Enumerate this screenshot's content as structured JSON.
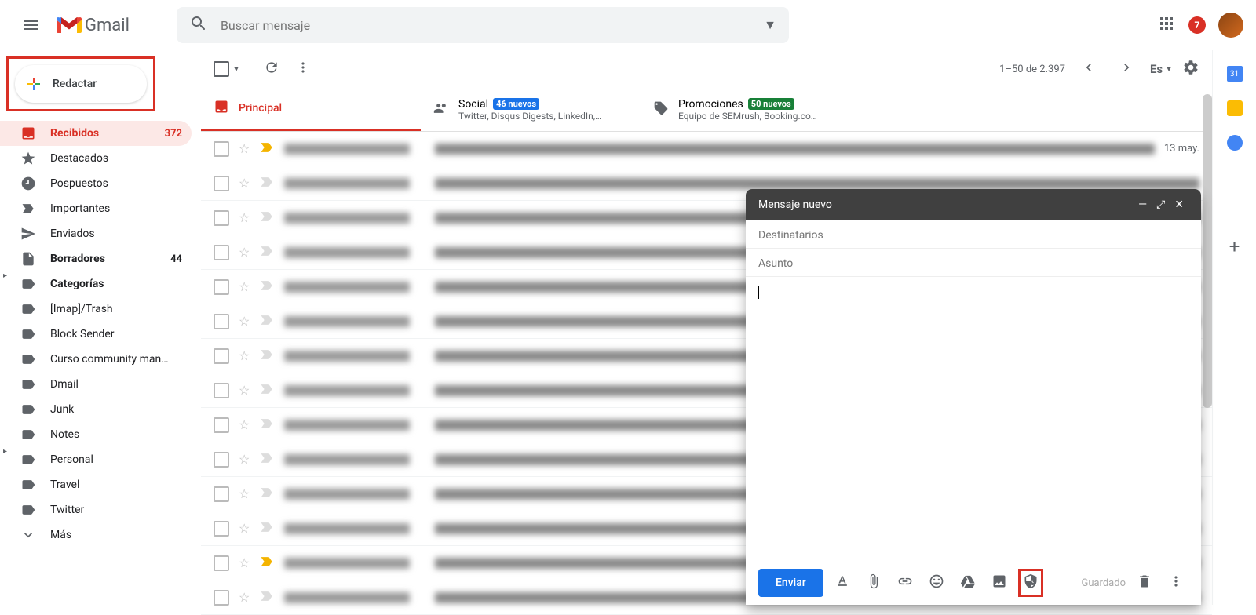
{
  "header": {
    "logo_text": "Gmail",
    "search_placeholder": "Buscar mensaje",
    "notif_count": "7"
  },
  "sidebar": {
    "compose": "Redactar",
    "items": [
      {
        "label": "Recibidos",
        "count": "372",
        "icon": "inbox",
        "active": true
      },
      {
        "label": "Destacados",
        "icon": "star"
      },
      {
        "label": "Pospuestos",
        "icon": "clock"
      },
      {
        "label": "Importantes",
        "icon": "important"
      },
      {
        "label": "Enviados",
        "icon": "sent"
      },
      {
        "label": "Borradores",
        "count": "44",
        "icon": "draft",
        "bold": true
      },
      {
        "label": "Categorías",
        "icon": "label",
        "bold": true,
        "expand": true
      },
      {
        "label": "[Imap]/Trash",
        "icon": "label"
      },
      {
        "label": "Block Sender",
        "icon": "label"
      },
      {
        "label": "Curso community man…",
        "icon": "label"
      },
      {
        "label": "Dmail",
        "icon": "label"
      },
      {
        "label": "Junk",
        "icon": "label"
      },
      {
        "label": "Notes",
        "icon": "label"
      },
      {
        "label": "Personal",
        "icon": "label",
        "expand": true
      },
      {
        "label": "Travel",
        "icon": "label"
      },
      {
        "label": "Twitter",
        "icon": "label"
      },
      {
        "label": "Más",
        "icon": "more"
      }
    ]
  },
  "toolbar": {
    "page_info": "1–50 de 2.397",
    "lang": "Es"
  },
  "tabs": [
    {
      "title": "Principal",
      "icon": "inbox",
      "active": true
    },
    {
      "title": "Social",
      "badge": "46 nuevos",
      "sub": "Twitter, Disqus Digests, LinkedIn,…",
      "icon": "people"
    },
    {
      "title": "Promociones",
      "badge": "50 nuevos",
      "badge_green": true,
      "sub": "Equipo de SEMrush, Booking.co…",
      "icon": "tag"
    }
  ],
  "emails": [
    {
      "date": "13 may.",
      "important": true
    },
    {
      "date": ""
    },
    {
      "date": ""
    },
    {
      "date": ""
    },
    {
      "date": ""
    },
    {
      "date": ""
    },
    {
      "date": ""
    },
    {
      "date": ""
    },
    {
      "date": ""
    },
    {
      "date": ""
    },
    {
      "date": ""
    },
    {
      "date": ""
    },
    {
      "date": "",
      "important": true
    },
    {
      "date": ""
    }
  ],
  "compose": {
    "title": "Mensaje nuevo",
    "to_placeholder": "Destinatarios",
    "subject_placeholder": "Asunto",
    "send": "Enviar",
    "saved": "Guardado"
  }
}
